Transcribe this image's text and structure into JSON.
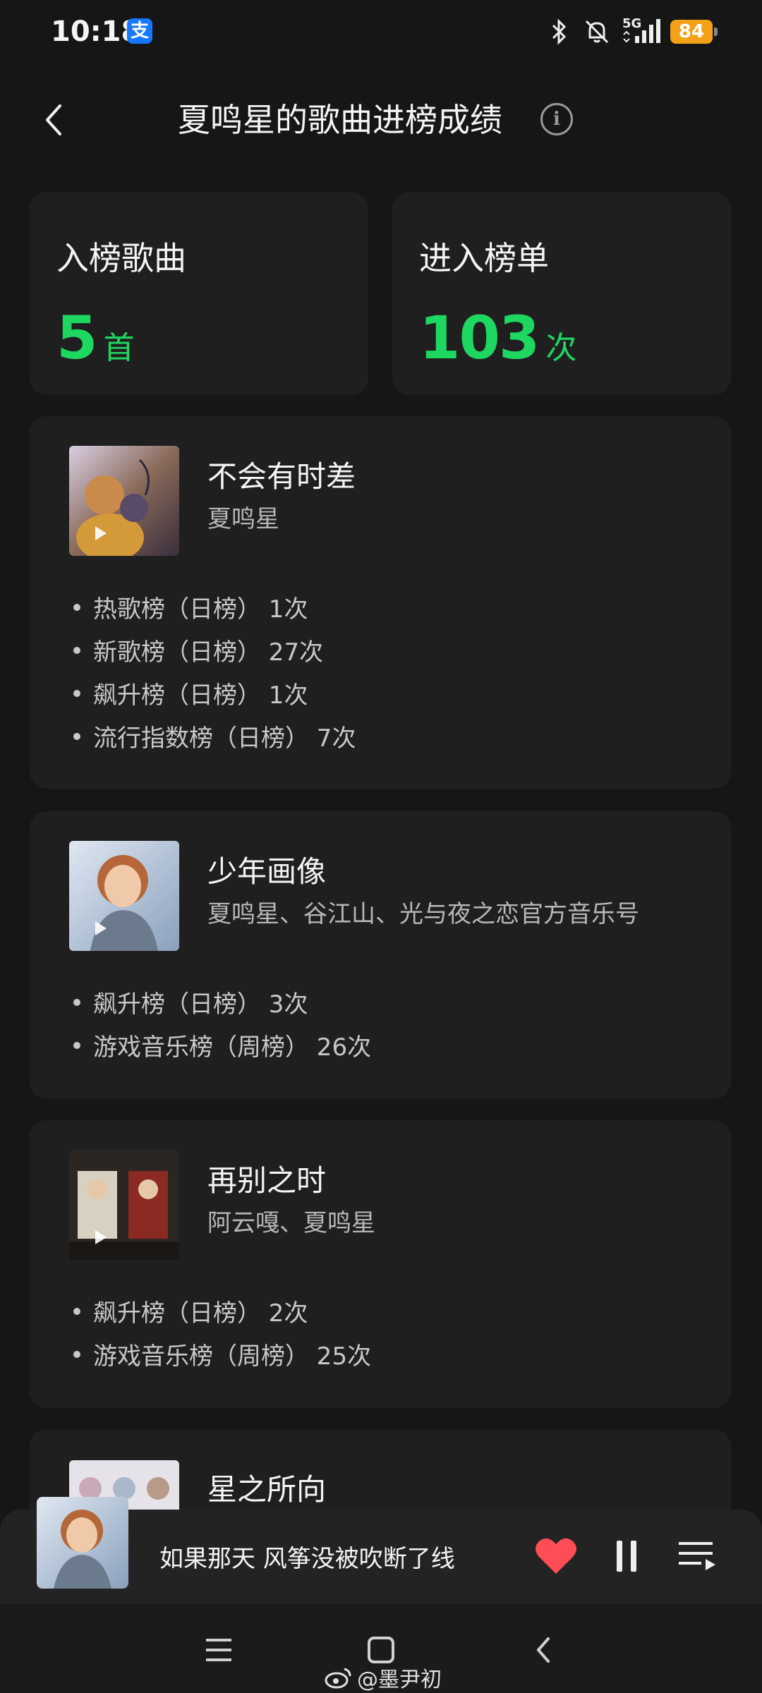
{
  "status_bar": {
    "time": "10:18",
    "alipay_glyph": "支",
    "network": "5G",
    "battery": "84",
    "icons": [
      "bluetooth-icon",
      "mute-icon",
      "signal-icon",
      "battery-icon"
    ]
  },
  "header": {
    "title": "夏鸣星的歌曲进榜成绩",
    "info_glyph": "i"
  },
  "stats": {
    "songs_label": "入榜歌曲",
    "songs_value": "5",
    "songs_unit": "首",
    "charts_label": "进入榜单",
    "charts_value": "103",
    "charts_unit": "次"
  },
  "songs": [
    {
      "title": "不会有时差",
      "artist": "夏鸣星",
      "entries": [
        "热歌榜（日榜） 1次",
        "新歌榜（日榜） 27次",
        "飙升榜（日榜） 1次",
        "流行指数榜（日榜） 7次"
      ]
    },
    {
      "title": "少年画像",
      "artist": "夏鸣星、谷江山、光与夜之恋官方音乐号",
      "entries": [
        "飙升榜（日榜） 3次",
        "游戏音乐榜（周榜） 26次"
      ]
    },
    {
      "title": "再别之时",
      "artist": "阿云嘎、夏鸣星",
      "entries": [
        "飙升榜（日榜） 2次",
        "游戏音乐榜（周榜） 25次"
      ]
    },
    {
      "title": "星之所向",
      "artist": "",
      "entries": []
    }
  ],
  "player": {
    "now_playing": "如果那天 风筝没被吹断了线"
  },
  "watermark": "@墨尹初",
  "colors": {
    "accent": "#1ed760",
    "background": "#161616",
    "card": "#1f1f1f",
    "heart": "#ff4d55"
  }
}
